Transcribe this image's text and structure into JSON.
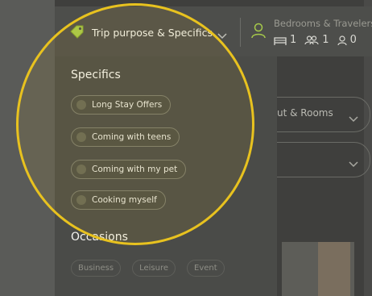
{
  "search_bar": {
    "trip_purpose_label": "Trip purpose & Specifics",
    "bedrooms_title": "Bedrooms & Travelers",
    "bedrooms_count": "1",
    "adults_count": "1",
    "children_count": "0"
  },
  "dropdown": {
    "specifics_title": "Specifics",
    "specifics": [
      {
        "label": "Long Stay Offers"
      },
      {
        "label": "Coming with teens"
      },
      {
        "label": "Coming with my pet"
      },
      {
        "label": "Cooking myself"
      }
    ],
    "occasions_title": "Occasions",
    "occasions": [
      {
        "label": "Business"
      },
      {
        "label": "Leisure"
      },
      {
        "label": "Event"
      }
    ]
  },
  "background": {
    "layout_rooms_label": "ut & Rooms"
  },
  "colors": {
    "highlight": "#e8c21f",
    "tag_icon": "#a6c94a",
    "person_icon": "#a6c94a"
  }
}
